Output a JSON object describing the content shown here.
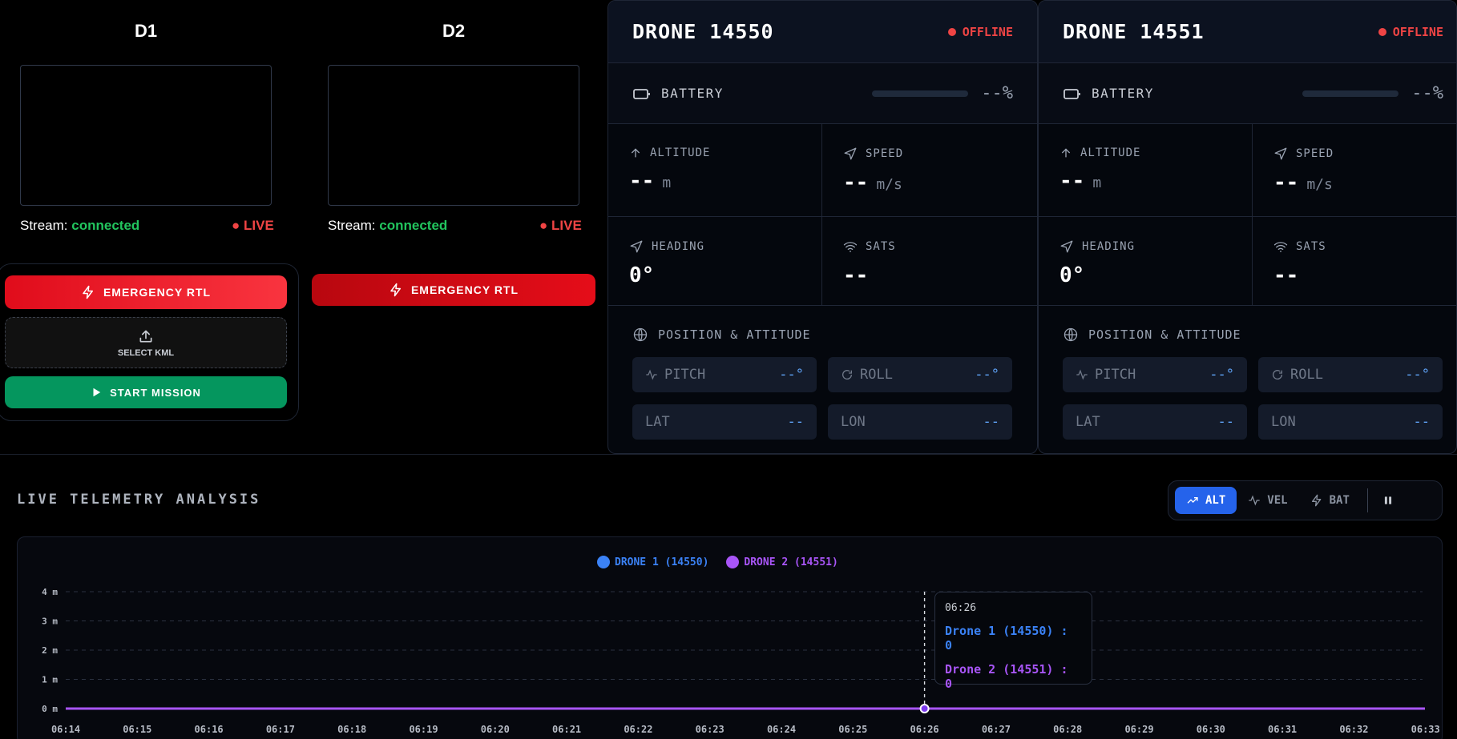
{
  "cameras": [
    {
      "title": "D1",
      "stream_label": "Stream:",
      "stream_status": "connected",
      "live": "LIVE"
    },
    {
      "title": "D2",
      "stream_label": "Stream:",
      "stream_status": "connected",
      "live": "LIVE"
    }
  ],
  "controls": {
    "emergency_label": "EMERGENCY RTL",
    "kml_label": "SELECT KML",
    "start_label": "START MISSION"
  },
  "drones": [
    {
      "name": "DRONE 14550",
      "status": "OFFLINE",
      "battery_label": "BATTERY",
      "battery_value": "--%",
      "altitude_label": "ALTITUDE",
      "altitude_value": "--",
      "altitude_unit": "m",
      "speed_label": "SPEED",
      "speed_value": "--",
      "speed_unit": "m/s",
      "heading_label": "HEADING",
      "heading_value": "0°",
      "sats_label": "SATS",
      "sats_value": "--",
      "position_label": "POSITION & ATTITUDE",
      "pitch_label": "PITCH",
      "pitch_value": "--°",
      "roll_label": "ROLL",
      "roll_value": "--°",
      "lat_label": "LAT",
      "lat_value": "--",
      "lon_label": "LON",
      "lon_value": "--"
    },
    {
      "name": "DRONE 14551",
      "status": "OFFLINE",
      "battery_label": "BATTERY",
      "battery_value": "--%",
      "altitude_label": "ALTITUDE",
      "altitude_value": "--",
      "altitude_unit": "m",
      "speed_label": "SPEED",
      "speed_value": "--",
      "speed_unit": "m/s",
      "heading_label": "HEADING",
      "heading_value": "0°",
      "sats_label": "SATS",
      "sats_value": "--",
      "position_label": "POSITION & ATTITUDE",
      "pitch_label": "PITCH",
      "pitch_value": "--°",
      "roll_label": "ROLL",
      "roll_value": "--°",
      "lat_label": "LAT",
      "lat_value": "--",
      "lon_label": "LON",
      "lon_value": "--"
    }
  ],
  "telemetry": {
    "title": "LIVE TELEMETRY ANALYSIS",
    "tabs": [
      "ALT",
      "VEL",
      "BAT"
    ],
    "active_tab": "ALT",
    "tooltip": {
      "time": "06:26",
      "rows": [
        "Drone 1 (14550) : 0",
        "Drone 2 (14551) : 0"
      ]
    }
  },
  "colors": {
    "series1": "#3b82f6",
    "series2": "#a855f7",
    "accent": "#2563eb",
    "danger": "#ef4444",
    "success": "#22c55e"
  },
  "chart_data": {
    "type": "line",
    "x": [
      "06:14",
      "06:15",
      "06:16",
      "06:17",
      "06:18",
      "06:19",
      "06:20",
      "06:21",
      "06:22",
      "06:23",
      "06:24",
      "06:25",
      "06:26",
      "06:27",
      "06:28",
      "06:29",
      "06:30",
      "06:31",
      "06:32",
      "06:33"
    ],
    "series": [
      {
        "name": "DRONE 1 (14550)",
        "values": [
          0,
          0,
          0,
          0,
          0,
          0,
          0,
          0,
          0,
          0,
          0,
          0,
          0,
          0,
          0,
          0,
          0,
          0,
          0,
          0
        ],
        "color": "#3b82f6"
      },
      {
        "name": "DRONE 2 (14551)",
        "values": [
          0,
          0,
          0,
          0,
          0,
          0,
          0,
          0,
          0,
          0,
          0,
          0,
          0,
          0,
          0,
          0,
          0,
          0,
          0,
          0
        ],
        "color": "#a855f7"
      }
    ],
    "yticks": [
      "0 m",
      "1 m",
      "2 m",
      "3 m",
      "4 m"
    ],
    "ylim": [
      0,
      4
    ],
    "grid": true,
    "legend": "top-center",
    "highlight": "06:26"
  }
}
